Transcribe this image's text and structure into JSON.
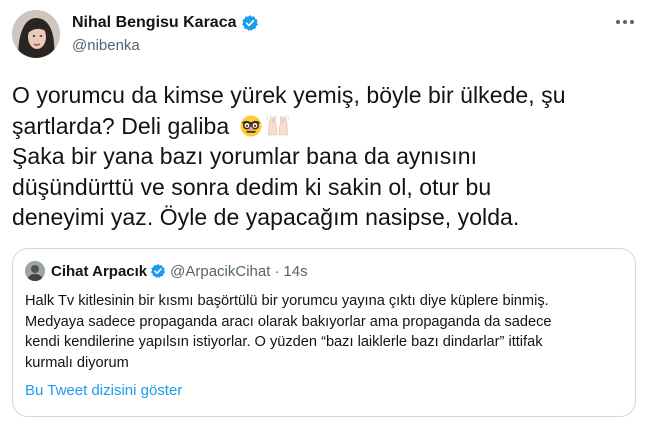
{
  "author": {
    "display_name": "Nihal Bengisu Karaca",
    "handle": "@nibenka"
  },
  "tweet": {
    "lines": [
      "O yorumcu da kimse yürek yemiş, böyle bir ülkede, şu",
      "şartlarda? Deli galiba",
      "Şaka bir yana bazı yorumlar bana da aynısını",
      "düşündürttü ve sonra dedim ki sakin ol, otur bu",
      "deneyimi yaz. Öyle de yapacağım nasipse, yolda."
    ],
    "emojis": [
      "disguised-face-emoji",
      "raised-hands-emoji"
    ]
  },
  "quoted": {
    "display_name": "Cihat Arpacık",
    "handle": "@ArpacikCihat",
    "separator": "·",
    "time": "14s",
    "lines": [
      "Halk Tv kitlesinin bir kısmı başörtülü bir yorumcu yayına çıktı diye küplere binmiş.",
      "Medyaya sadece propaganda aracı olarak bakıyorlar ama propaganda da sadece",
      "kendi kendilerine yapılsın istiyorlar. O yüzden “bazı laiklerle bazı dindarlar” ittifak",
      "kurmalı diyorum"
    ],
    "show_thread": "Bu Tweet dizisini göster"
  },
  "colors": {
    "verified": "#1d9bf0",
    "link": "#1d9bf0",
    "secondary_text": "#536471",
    "border": "#cfd9de"
  }
}
